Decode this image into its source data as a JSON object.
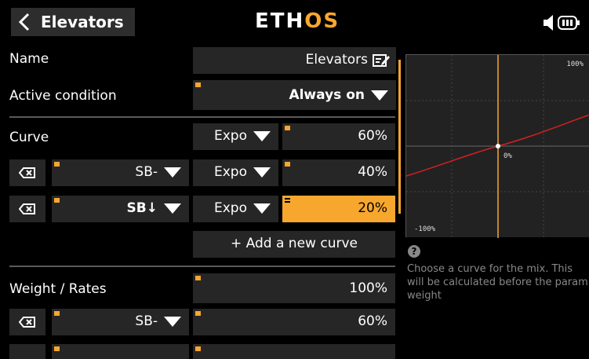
{
  "header": {
    "title": "Elevators",
    "logo_main": "ETH",
    "logo_accent": "OS"
  },
  "rows": {
    "name": {
      "label": "Name",
      "value": "Elevators"
    },
    "active": {
      "label": "Active condition",
      "value": "Always on"
    },
    "curve": {
      "label": "Curve",
      "type": "Expo",
      "value": "60%"
    },
    "curve2": {
      "switch": "SB-",
      "type": "Expo",
      "value": "40%"
    },
    "curve3": {
      "switch": "SB↓",
      "type": "Expo",
      "value": "20%"
    },
    "add_curve": "+ Add a new curve",
    "weight": {
      "label": "Weight / Rates",
      "value": "100%"
    },
    "weight2": {
      "switch": "SB-",
      "value": "60%"
    }
  },
  "graph": {
    "max_label": "100%",
    "min_label": "-100%",
    "center_label": "0%"
  },
  "help": {
    "text": "Choose a curve for the mix. This will be calculated before the param weight"
  },
  "colors": {
    "accent": "#f8a72e",
    "curve_line": "#d42020"
  }
}
